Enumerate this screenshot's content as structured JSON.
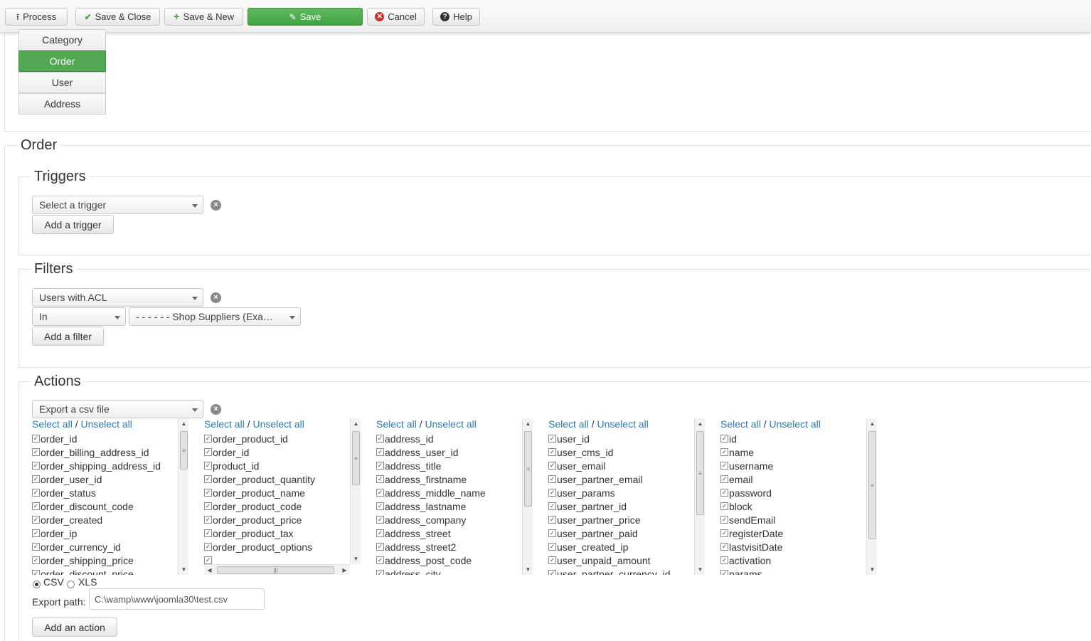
{
  "toolbar": {
    "process": "Process",
    "save_close": "Save & Close",
    "save_new": "Save & New",
    "save": "Save",
    "cancel": "Cancel",
    "help": "Help"
  },
  "tabs": [
    "Category",
    "Order",
    "User",
    "Address"
  ],
  "active_tab": "Order",
  "section_title": "Order",
  "triggers": {
    "legend": "Triggers",
    "select_value": "Select a trigger",
    "add_label": "Add a trigger"
  },
  "filters": {
    "legend": "Filters",
    "select_value": "Users with ACL",
    "operator_value": "In",
    "group_value": "- - - - - - Shop Suppliers (Exa…",
    "add_label": "Add a filter"
  },
  "actions": {
    "legend": "Actions",
    "select_value": "Export a csv file",
    "select_all": "Select all",
    "separator": "/",
    "unselect_all": "Unselect all",
    "columns": [
      {
        "items": [
          "order_id",
          "order_billing_address_id",
          "order_shipping_address_id",
          "order_user_id",
          "order_status",
          "order_discount_code",
          "order_created",
          "order_ip",
          "order_currency_id",
          "order_shipping_price",
          "order_discount_price"
        ]
      },
      {
        "items": [
          "order_product_id",
          "order_id",
          "product_id",
          "order_product_quantity",
          "order_product_name",
          "order_product_code",
          "order_product_price",
          "order_product_tax",
          "order_product_options",
          ""
        ]
      },
      {
        "items": [
          "address_id",
          "address_user_id",
          "address_title",
          "address_firstname",
          "address_middle_name",
          "address_lastname",
          "address_company",
          "address_street",
          "address_street2",
          "address_post_code",
          "address_city"
        ]
      },
      {
        "items": [
          "user_id",
          "user_cms_id",
          "user_email",
          "user_partner_email",
          "user_params",
          "user_partner_id",
          "user_partner_price",
          "user_partner_paid",
          "user_created_ip",
          "user_unpaid_amount",
          "user_partner_currency_id"
        ]
      },
      {
        "items": [
          "id",
          "name",
          "username",
          "email",
          "password",
          "block",
          "sendEmail",
          "registerDate",
          "lastvisitDate",
          "activation",
          "params"
        ]
      }
    ],
    "format_csv": "CSV",
    "format_xls": "XLS",
    "format_selected": "CSV",
    "export_path_label": "Export path:",
    "export_path_value": "C:\\wamp\\www\\joomla30\\test.csv",
    "add_label": "Add an action"
  },
  "colors": {
    "accent_green": "#52a752",
    "link_blue": "#2b7bb9",
    "cancel_red": "#c9302c"
  }
}
